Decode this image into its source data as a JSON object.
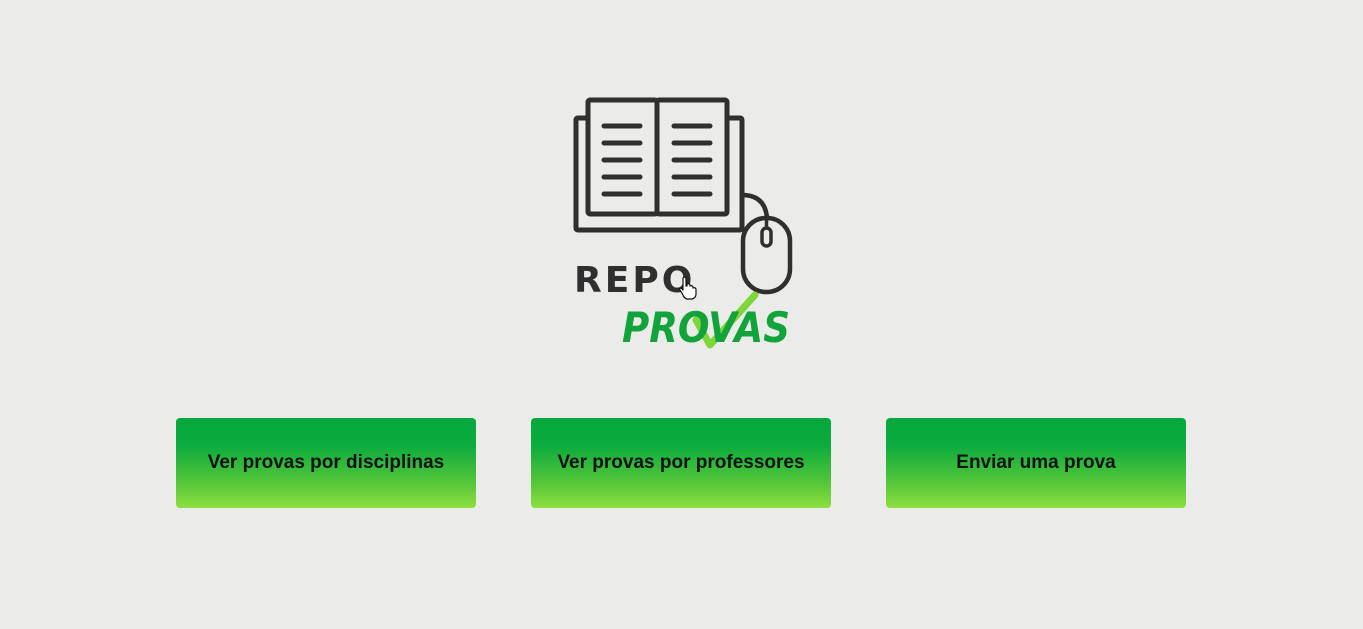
{
  "logo": {
    "text_top": "REPO",
    "text_bottom": "PROVAS"
  },
  "buttons": [
    {
      "label": "Ver provas por disciplinas"
    },
    {
      "label": "Ver provas por professores"
    },
    {
      "label": "Enviar uma prova"
    }
  ],
  "colors": {
    "background": "#ebebe9",
    "button_top": "#07a83c",
    "button_bottom": "#8ddf3e",
    "logo_dark": "#2f2f2f",
    "logo_green": "#12a33a",
    "check_green": "#7fd63a"
  },
  "icons": {
    "book": "open-book-icon",
    "mouse": "computer-mouse-icon",
    "check": "checkmark-icon",
    "cursor": "hand-pointer-icon"
  }
}
